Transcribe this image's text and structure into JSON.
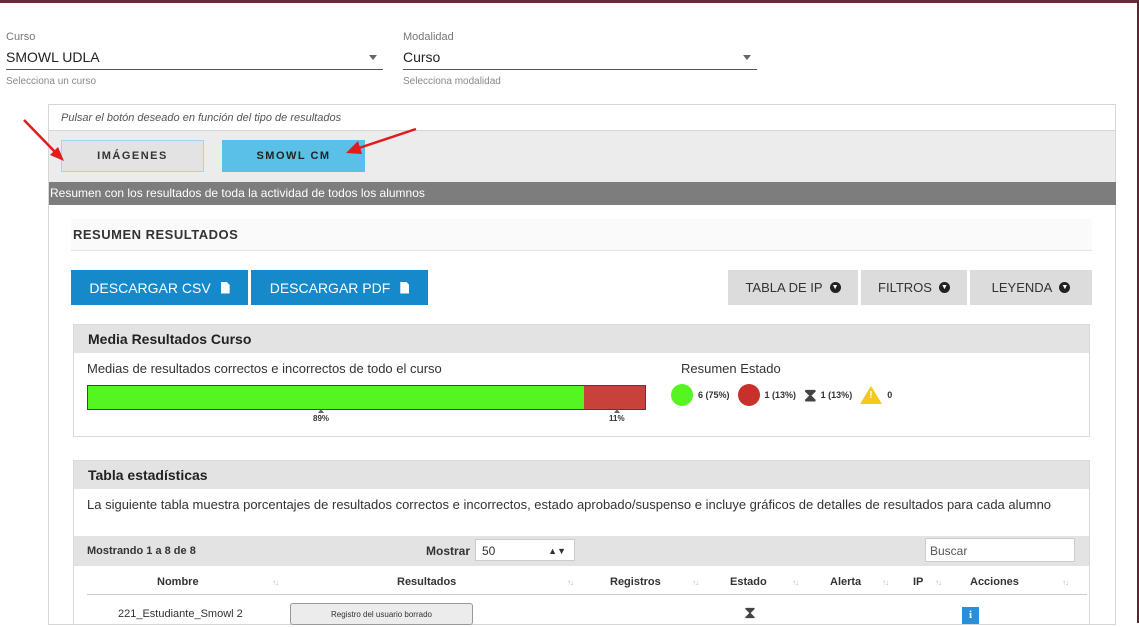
{
  "course_field": {
    "label": "Curso",
    "value": "SMOWL UDLA",
    "hint": "Selecciona un curso"
  },
  "modality_field": {
    "label": "Modalidad",
    "value": "Curso",
    "hint": "Selecciona modalidad"
  },
  "panel": {
    "hint": "Pulsar el botón deseado en función del tipo de resultados",
    "btn_images": "IMÁGENES",
    "btn_smowl_cm": "SMOWL CM",
    "summary_bar": "Resumen con los resultados de toda la actividad de todos los alumnos"
  },
  "summary": {
    "title": "RESUMEN RESULTADOS",
    "download_csv": "DESCARGAR CSV",
    "download_pdf": "DESCARGAR PDF",
    "ip_table": "TABLA DE IP",
    "filters": "FILTROS",
    "legend": "LEYENDA"
  },
  "course_avg": {
    "title": "Media Resultados Curso",
    "description": "Medias de resultados correctos e incorrectos de todo el curso",
    "correct_pct": 89,
    "incorrect_pct": 11,
    "correct_label": "89%",
    "incorrect_label": "11%",
    "status_title": "Resumen Estado",
    "status_pass": "6 (75%)",
    "status_fail": "1 (13%)",
    "status_pending": "1 (13%)",
    "status_alert": "0",
    "colors": {
      "pass": "#55f521",
      "fail": "#c7302b",
      "alert": "#f5c91b"
    }
  },
  "stats_table": {
    "title": "Tabla estadísticas",
    "description": "La siguiente tabla muestra porcentajes de resultados correctos e incorrectos, estado aprobado/suspenso e incluye gráficos de detalles de resultados para cada alumno",
    "showing": "Mostrando 1 a 8 de 8",
    "show_label": "Mostrar",
    "show_value": "50",
    "search_placeholder": "Buscar",
    "columns": [
      "Nombre",
      "Resultados",
      "Registros",
      "Estado",
      "Alerta",
      "IP",
      "Acciones"
    ],
    "rows": [
      {
        "name": "221_Estudiante_Smowl 2",
        "result": "Registro del usuario borrado",
        "status_icon": "hourglass-icon",
        "action_icon": "info-icon"
      }
    ]
  }
}
